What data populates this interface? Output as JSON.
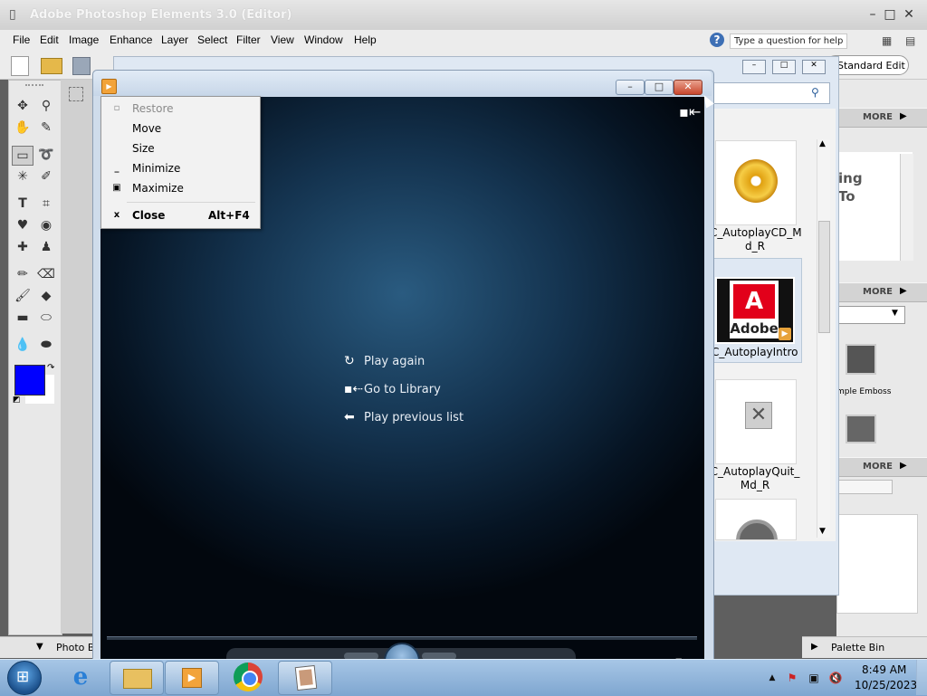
{
  "pse": {
    "title": "Adobe Photoshop Elements 3.0 (Editor)",
    "menu": [
      "File",
      "Edit",
      "Image",
      "Enhance",
      "Layer",
      "Select",
      "Filter",
      "View",
      "Window",
      "Help"
    ],
    "help_placeholder": "Type a question for help",
    "standard_edit": "Standard Edit",
    "photo_bin": "Photo Bin",
    "palette_bin": "Palette Bin",
    "more_label": "MORE",
    "fg_color": "#0000ff",
    "bg_color": "#ffffff"
  },
  "palette": {
    "effect_label": "mple Emboss",
    "help_text_1": "ing",
    "help_text_2": "To"
  },
  "organizer": {
    "items": [
      {
        "label": "C_AutoplayCD_M d_R"
      },
      {
        "label": "C_AutoplayIntro"
      },
      {
        "label": "C_AutoplayQuit_ Md_R"
      }
    ],
    "adobe_logo_text": "Adobe"
  },
  "wmp": {
    "actions": [
      {
        "icon": "refresh-icon",
        "label": "Play again"
      },
      {
        "icon": "library-icon",
        "label": "Go to Library"
      },
      {
        "icon": "back-arrow-icon",
        "label": "Play previous list"
      }
    ]
  },
  "sysmenu": {
    "items": [
      {
        "label": "Restore",
        "glyph": "▫",
        "disabled": true
      },
      {
        "label": "Move",
        "glyph": ""
      },
      {
        "label": "Size",
        "glyph": ""
      },
      {
        "label": "Minimize",
        "glyph": "‗"
      },
      {
        "label": "Maximize",
        "glyph": "□"
      },
      {
        "label": "Close",
        "glyph": "x",
        "accel": "Alt+F4",
        "bold": true
      }
    ]
  },
  "taskbar": {
    "time": "8:49 AM",
    "date": "10/25/2023"
  }
}
